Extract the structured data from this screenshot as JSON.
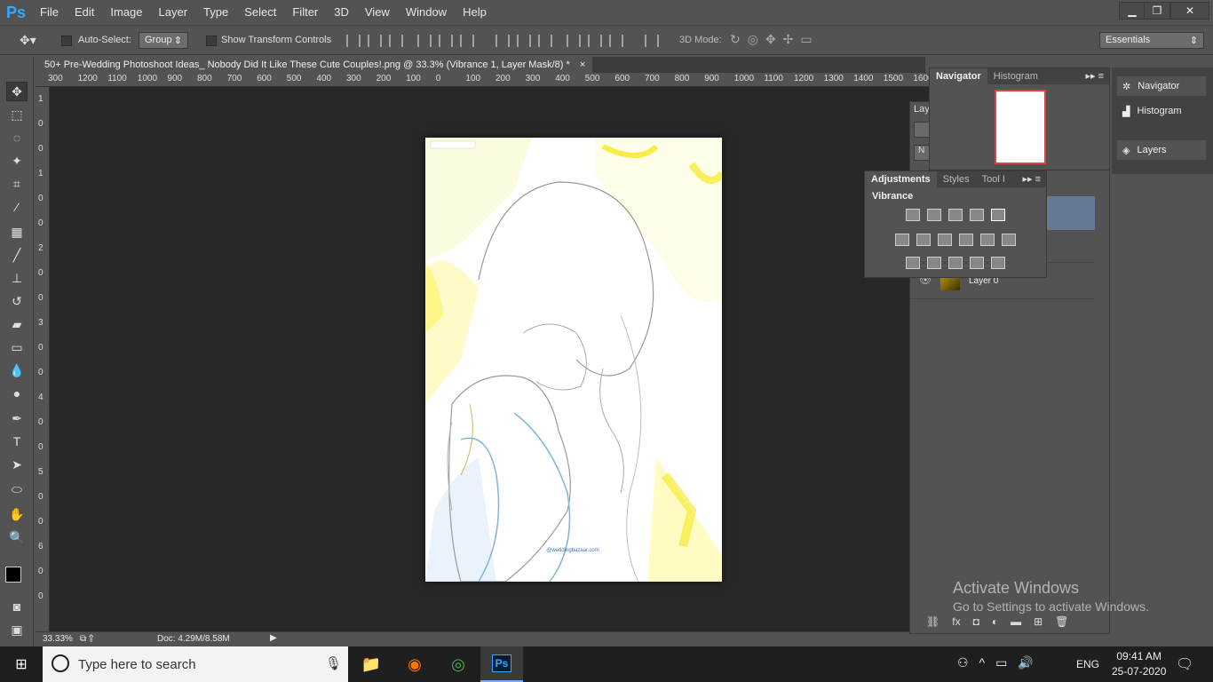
{
  "app": {
    "logo": "Ps"
  },
  "menu": [
    "File",
    "Edit",
    "Image",
    "Layer",
    "Type",
    "Select",
    "Filter",
    "3D",
    "View",
    "Window",
    "Help"
  ],
  "window_controls": {
    "minimize": "▁",
    "restore": "❐",
    "close": "✕"
  },
  "options_bar": {
    "auto_select_label": "Auto-Select:",
    "auto_select_value": "Group",
    "show_transform_label": "Show Transform Controls",
    "mode_3d_label": "3D Mode:",
    "workspace": "Essentials"
  },
  "document_tab": {
    "title": "50+ Pre-Wedding Photoshoot Ideas_ Nobody Did It Like These Cute Couples!.png @ 33.3% (Vibrance 1, Layer Mask/8) *",
    "close": "×"
  },
  "ruler_h": [
    "300",
    "1200",
    "1100",
    "1000",
    "900",
    "800",
    "700",
    "600",
    "500",
    "400",
    "300",
    "200",
    "100",
    "0",
    "100",
    "200",
    "300",
    "400",
    "500",
    "600",
    "700",
    "800",
    "900",
    "1000",
    "1100",
    "1200",
    "1300",
    "1400",
    "1500",
    "1600"
  ],
  "ruler_v": [
    "1",
    "0",
    "0",
    "1",
    "0",
    "0",
    "2",
    "0",
    "0",
    "3",
    "0",
    "0",
    "4",
    "0",
    "0",
    "5",
    "0",
    "0",
    "6",
    "0",
    "0"
  ],
  "status": {
    "zoom": "33.33%",
    "doc": "Doc: 4.29M/8.58M"
  },
  "navigator_panel": {
    "tabs": [
      "Navigator",
      "Histogram"
    ]
  },
  "layers_panel": {
    "tab_partial": "Lay",
    "kind_partial": "N",
    "vibrance_layer_suffix": "1",
    "layer0_name": "Layer 0"
  },
  "adjustments_panel": {
    "tabs": [
      "Adjustments",
      "Styles",
      "Tool I"
    ],
    "current": "Vibrance"
  },
  "right_dock": {
    "navigator": "Navigator",
    "histogram": "Histogram",
    "layers": "Layers"
  },
  "photo_watermark": "@weddingbazaar.com",
  "activate": {
    "title": "Activate Windows",
    "subtitle": "Go to Settings to activate Windows."
  },
  "taskbar": {
    "search_placeholder": "Type here to search",
    "lang": "ENG",
    "time": "09:41 AM",
    "date": "25-07-2020"
  }
}
